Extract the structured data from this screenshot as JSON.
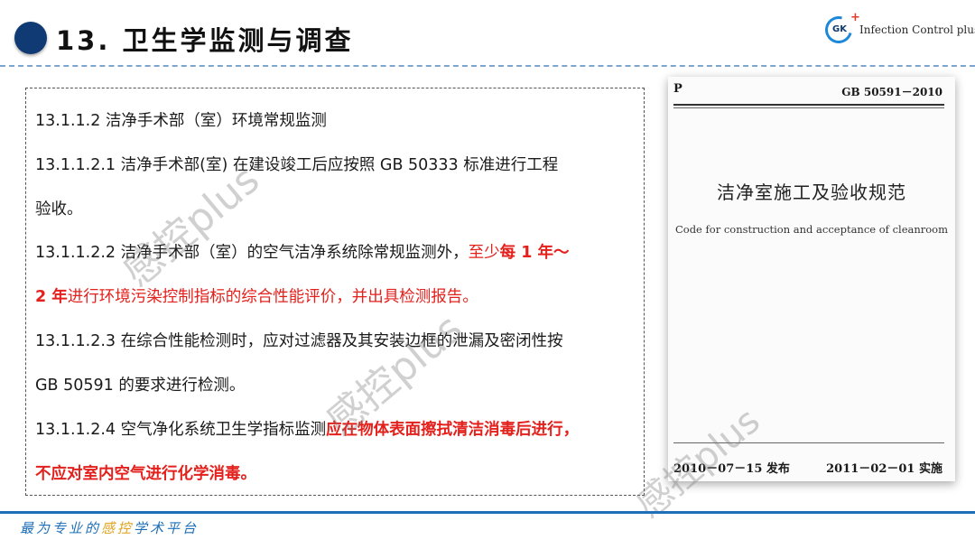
{
  "header": {
    "title": "13. 卫生学监测与调查",
    "logo_mark": "GK",
    "logo_text": "Infection Control plus"
  },
  "content": {
    "p1": "13.1.1.2 洁净手术部（室）环境常规监测",
    "p2a": "13.1.1.2.1 洁净手术部(室) 在建设竣工后应按照 GB 50333 标准进行工程",
    "p2b": "验收。",
    "p3a_normal": "13.1.1.2.2 洁净手术部（室）的空气洁净系统除常规监测外，",
    "p3a_red": "至少",
    "p3a_red_bold": "每 1 年～",
    "p3b_red_bold": "2 年",
    "p3b_red": "进行环境污染控制指标的综合性能评价，并出具检测报告。",
    "p4a": "13.1.1.2.3 在综合性能检测时，应对过滤器及其安装边框的泄漏及密闭性按",
    "p4b": "GB 50591 的要求进行检测。",
    "p5a_normal": "13.1.1.2.4 空气净化系统卫生学指标监测",
    "p5a_red": "应在物体表面擦拭清洁消毒后进行，",
    "p5b_red": "不应对室内空气进行化学消毒。"
  },
  "cover": {
    "p_mark": "P",
    "code": "GB 50591－2010",
    "title_cn": "洁净室施工及验收规范",
    "title_en": "Code for construction and acceptance of cleanroom",
    "publish": "2010－07－15  发布",
    "implement": "2011－02－01  实施"
  },
  "watermark": {
    "text": "感控plus"
  },
  "footer": {
    "pre": "最为专业的",
    "highlight": "感控",
    "post": "学术平台"
  },
  "colors": {
    "accent_blue": "#1e6fb8",
    "dot_navy": "#0f3a73",
    "emphasis_red": "#e3201b",
    "footer_gold": "#e0a21c"
  }
}
